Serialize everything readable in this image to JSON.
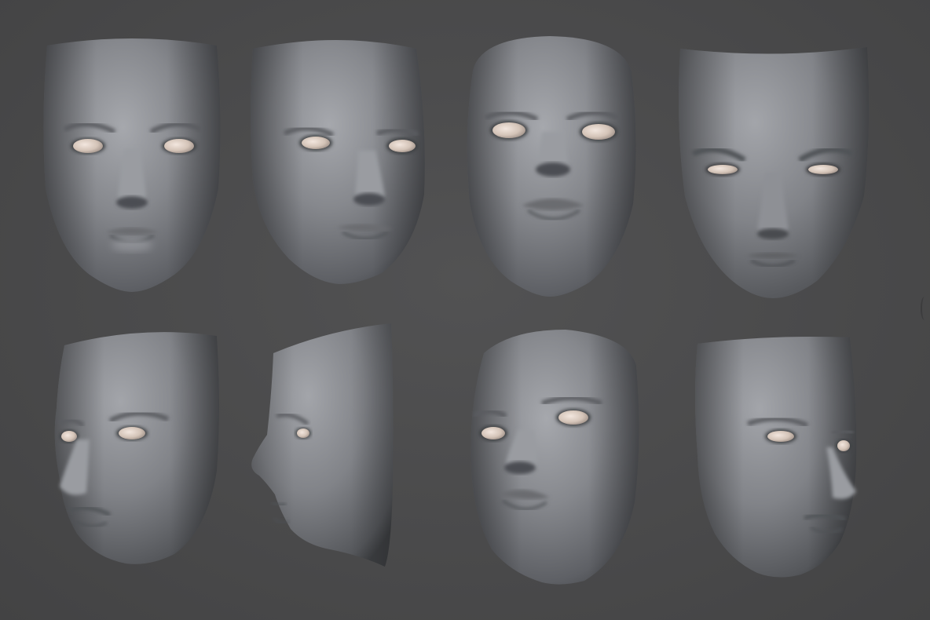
{
  "scene": {
    "background_color": "#4a4a4b",
    "clay_color": "#8a8c91",
    "eye_color": "#d8c8bc"
  },
  "faces": [
    {
      "view": "front"
    },
    {
      "view": "front-slight-left"
    },
    {
      "view": "front-looking-up"
    },
    {
      "view": "front-looking-down"
    },
    {
      "view": "three-quarter-left"
    },
    {
      "view": "profile-left"
    },
    {
      "view": "three-quarter-up-left"
    },
    {
      "view": "three-quarter-right"
    }
  ]
}
